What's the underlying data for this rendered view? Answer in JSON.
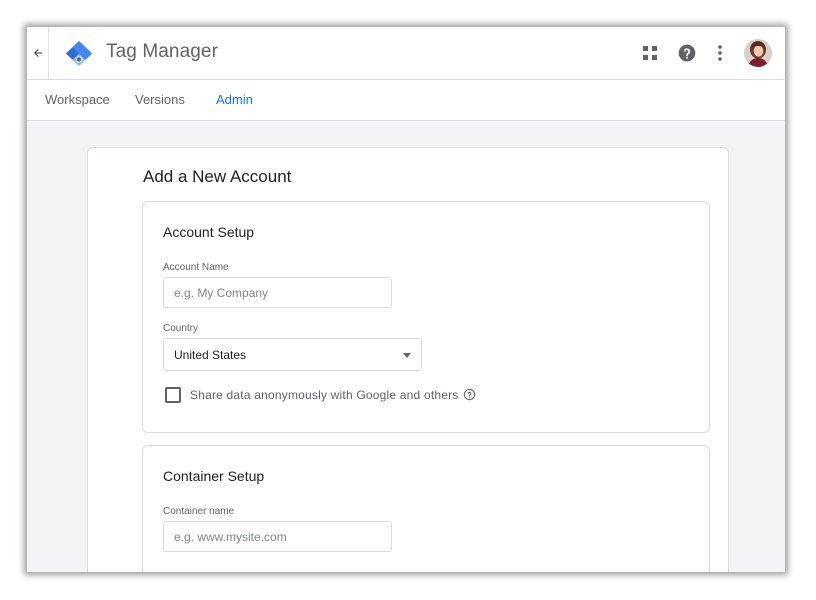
{
  "header": {
    "app_title": "Tag Manager",
    "back_icon": "arrow-left-icon",
    "apps_icon": "apps-grid-icon",
    "help_icon": "help-circle-icon",
    "more_icon": "more-vert-icon"
  },
  "nav": {
    "tabs": [
      {
        "label": "Workspace",
        "active": false
      },
      {
        "label": "Versions",
        "active": false
      },
      {
        "label": "Admin",
        "active": true
      }
    ]
  },
  "form": {
    "title": "Add a New Account",
    "account_setup": {
      "title": "Account Setup",
      "account_name_label": "Account Name",
      "account_name_placeholder": "e.g. My Company",
      "account_name_value": "",
      "country_label": "Country",
      "country_value": "United States",
      "share_data_label": "Share data anonymously with Google and others",
      "share_data_checked": false
    },
    "container_setup": {
      "title": "Container Setup",
      "container_name_label": "Container name",
      "container_name_placeholder": "e.g. www.mysite.com",
      "container_name_value": ""
    }
  },
  "colors": {
    "accent": "#1a73e8",
    "logo_light": "#8ab4f8",
    "logo_dark": "#4285f4",
    "logo_mid": "#246fdb",
    "background": "#f1f3f4",
    "text_secondary": "#5f6368"
  }
}
